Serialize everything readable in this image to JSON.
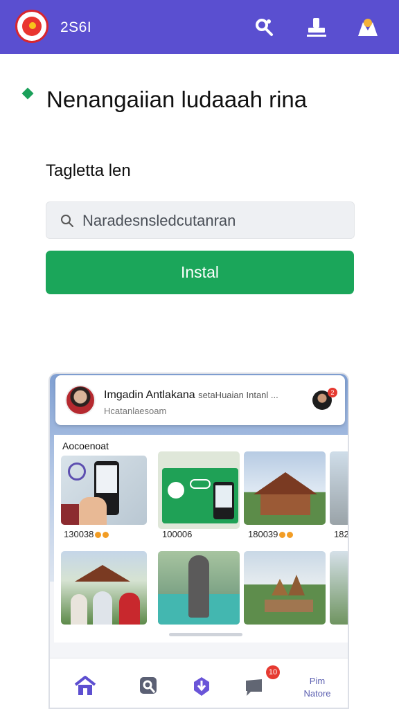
{
  "topbar": {
    "app_code": "2S6I",
    "icons": [
      "logo-emblem-icon",
      "tools-icon",
      "stamp-icon",
      "profile-icon"
    ]
  },
  "header": {
    "title": "Nenangaiian ludaaah rina",
    "subtitle": "Tagletta len"
  },
  "search": {
    "placeholder": "Naradesnsledcutanran"
  },
  "install_button": {
    "label": "Instal"
  },
  "preview": {
    "card": {
      "title": "Imgadin Antlakana",
      "title_extra": "setaHuaian Intanl ...",
      "subtitle": "Hcatanlaesoam",
      "badge": "2"
    },
    "section_label": "Aocoenoat",
    "prices": [
      "130038",
      "100006",
      "180039",
      "182"
    ],
    "nav": {
      "badge": "10",
      "text_line1": "Pim",
      "text_line2": "Natore"
    }
  },
  "colors": {
    "topbar": "#5a4fd0",
    "accent_green": "#1ba65a",
    "nav_purple": "#5b5fb0",
    "badge_red": "#e63a31"
  }
}
